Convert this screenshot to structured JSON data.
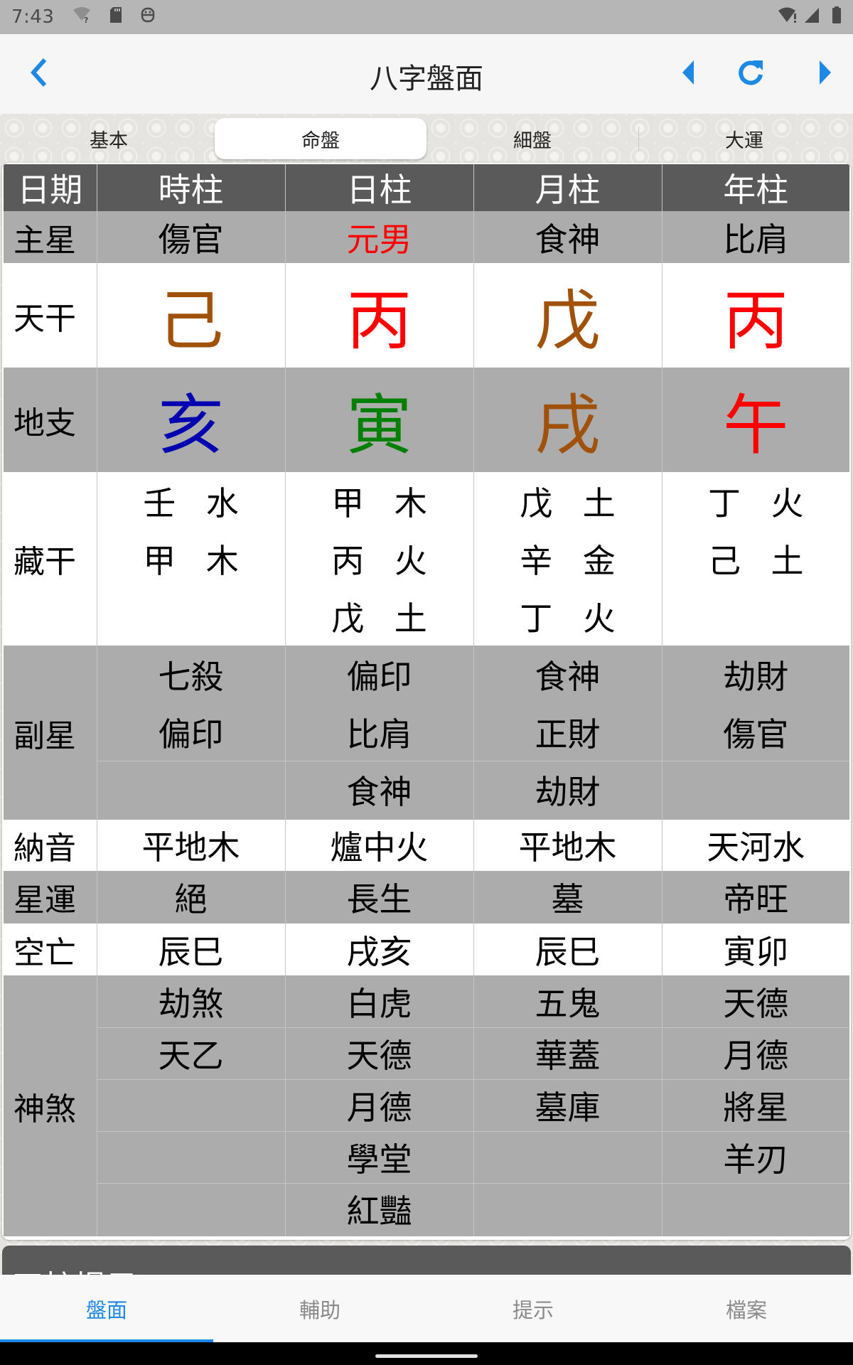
{
  "status_bar": {
    "time": "7:43",
    "left_icons": [
      "wifi-unknown-icon",
      "sd-card-icon",
      "app-notification-icon"
    ],
    "right_icons": [
      "wifi-alert-icon",
      "cell-signal-icon",
      "battery-icon"
    ]
  },
  "app_bar": {
    "title": "八字盤面",
    "back_icon": "chevron-left-icon",
    "prev_icon": "triangle-left-icon",
    "refresh_icon": "refresh-icon",
    "next_icon": "triangle-right-icon"
  },
  "segments": {
    "items": [
      "基本",
      "命盤",
      "細盤",
      "大運"
    ],
    "active_index": 1
  },
  "colors": {
    "accent": "#1e88e5",
    "earth": "#a0520a",
    "fire": "#ff0000",
    "water": "#0000b0",
    "wood": "#008000",
    "header_bg": "#5a5a5a",
    "row_gray": "#acacac"
  },
  "table": {
    "header": [
      "日期",
      "時柱",
      "日柱",
      "月柱",
      "年柱"
    ],
    "main_star": {
      "label": "主星",
      "values": [
        "傷官",
        "元男",
        "食神",
        "比肩"
      ]
    },
    "heavenly_stem": {
      "label": "天干",
      "values": [
        "己",
        "丙",
        "戊",
        "丙"
      ],
      "colors": [
        "#a0520a",
        "#ff0000",
        "#a0520a",
        "#ff0000"
      ]
    },
    "earthly_branch": {
      "label": "地支",
      "values": [
        "亥",
        "寅",
        "戌",
        "午"
      ],
      "colors": [
        "#0000b0",
        "#008000",
        "#a0520a",
        "#ff0000"
      ]
    },
    "hidden_stems": {
      "label": "藏干",
      "values": [
        [
          "壬水",
          "甲木"
        ],
        [
          "甲木",
          "丙火",
          "戊土"
        ],
        [
          "戊土",
          "辛金",
          "丁火"
        ],
        [
          "丁火",
          "己土"
        ]
      ]
    },
    "sub_star": {
      "label": "副星",
      "values": [
        [
          "七殺",
          "偏印"
        ],
        [
          "偏印",
          "比肩",
          "食神"
        ],
        [
          "食神",
          "正財",
          "劫財"
        ],
        [
          "劫財",
          "傷官"
        ]
      ]
    },
    "nayin": {
      "label": "納音",
      "values": [
        "平地木",
        "爐中火",
        "平地木",
        "天河水"
      ]
    },
    "star_fortune": {
      "label": "星運",
      "values": [
        "絕",
        "長生",
        "墓",
        "帝旺"
      ]
    },
    "void": {
      "label": "空亡",
      "values": [
        "辰巳",
        "戌亥",
        "辰巳",
        "寅卯"
      ]
    },
    "spirits": {
      "label": "神煞",
      "values": [
        [
          "劫煞",
          "天乙"
        ],
        [
          "白虎",
          "天德",
          "月德",
          "學堂",
          "紅豔"
        ],
        [
          "五鬼",
          "華蓋",
          "墓庫"
        ],
        [
          "天德",
          "月德",
          "將星",
          "羊刃"
        ]
      ]
    }
  },
  "tips_section": {
    "title": "四柱提示"
  },
  "bottom_nav": {
    "items": [
      "盤面",
      "輔助",
      "提示",
      "檔案"
    ],
    "active_index": 0
  }
}
